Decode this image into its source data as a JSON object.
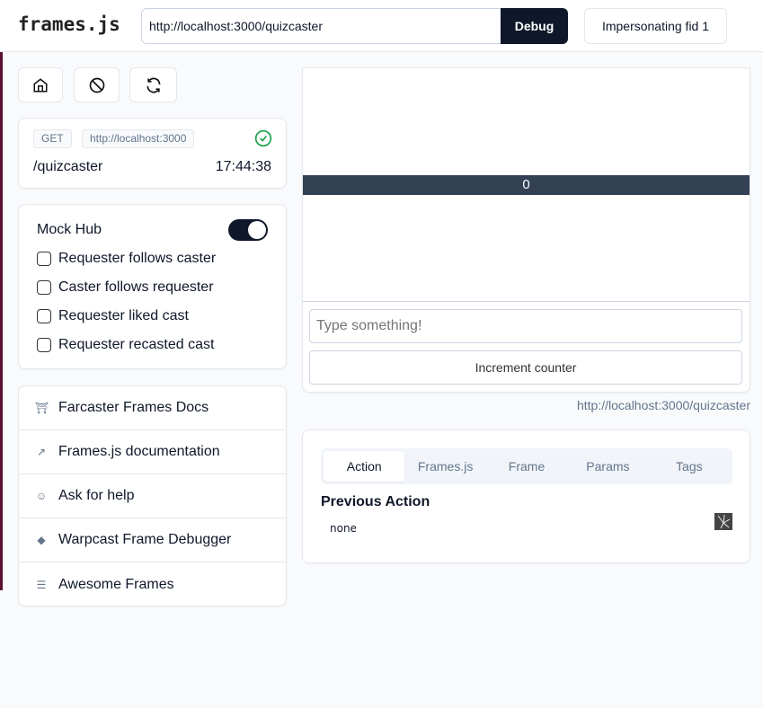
{
  "header": {
    "logo": "frames.js",
    "url_value": "http://localhost:3000/quizcaster",
    "debug_label": "Debug",
    "impersonate_label": "Impersonating fid 1"
  },
  "toolbar": {
    "icons": [
      "home-icon",
      "ban-icon",
      "refresh-icon"
    ]
  },
  "request": {
    "method": "GET",
    "host": "http://localhost:3000",
    "path": "/quizcaster",
    "time": "17:44:38",
    "status": "success"
  },
  "mock_hub": {
    "label": "Mock Hub",
    "enabled": true,
    "options": [
      {
        "label": "Requester follows caster",
        "checked": false
      },
      {
        "label": "Caster follows requester",
        "checked": false
      },
      {
        "label": "Requester liked cast",
        "checked": false
      },
      {
        "label": "Requester recasted cast",
        "checked": false
      }
    ]
  },
  "links": [
    {
      "label": "Farcaster Frames Docs",
      "icon": "farcaster-icon"
    },
    {
      "label": "Frames.js documentation",
      "icon": "arrow-up-right-icon"
    },
    {
      "label": "Ask for help",
      "icon": "chat-heart-icon"
    },
    {
      "label": "Warpcast Frame Debugger",
      "icon": "diamond-icon"
    },
    {
      "label": "Awesome Frames",
      "icon": "list-icon"
    }
  ],
  "frame": {
    "counter": "0",
    "input_placeholder": "Type something!",
    "button_label": "Increment counter",
    "url": "http://localhost:3000/quizcaster"
  },
  "debug_panel": {
    "tabs": [
      "Action",
      "Frames.js",
      "Frame",
      "Params",
      "Tags"
    ],
    "active_tab": "Action",
    "heading": "Previous Action",
    "value": "none"
  },
  "colors": {
    "primary": "#0f172a",
    "frame_bar": "#334155",
    "success": "#16a34a"
  }
}
